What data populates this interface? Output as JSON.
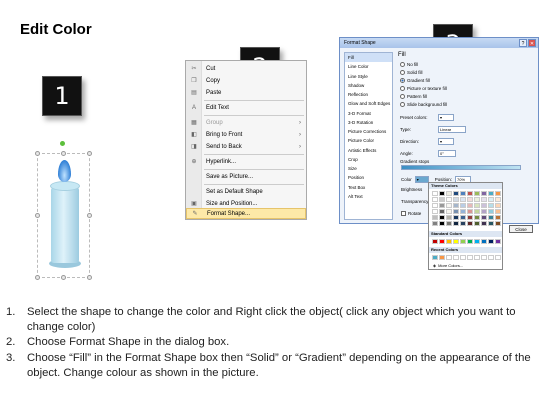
{
  "title": "Edit Color",
  "badges": [
    "1",
    "2",
    "3"
  ],
  "context_menu": {
    "items": [
      {
        "label": "Cut",
        "icon": "scissors-icon",
        "glyph": "✂"
      },
      {
        "label": "Copy",
        "icon": "copy-icon",
        "glyph": "❐"
      },
      {
        "label": "Paste",
        "icon": "paste-icon",
        "glyph": "▤"
      },
      {
        "label": "Edit Text",
        "icon": "edit-text-icon",
        "glyph": "A"
      },
      {
        "label": "Group",
        "icon": "group-icon",
        "glyph": "▦"
      },
      {
        "label": "Bring to Front",
        "icon": "bring-front-icon",
        "glyph": "◧"
      },
      {
        "label": "Send to Back",
        "icon": "send-back-icon",
        "glyph": "◨"
      },
      {
        "label": "Hyperlink...",
        "icon": "hyperlink-icon",
        "glyph": "⊕"
      },
      {
        "label": "Save as Picture...",
        "icon": "",
        "glyph": ""
      },
      {
        "label": "Set as Default Shape",
        "icon": "",
        "glyph": ""
      },
      {
        "label": "Size and Position...",
        "icon": "size-position-icon",
        "glyph": "▣"
      },
      {
        "label": "Format Shape...",
        "icon": "format-shape-icon",
        "glyph": "✎"
      }
    ]
  },
  "dialog": {
    "title": "Format Shape",
    "categories": [
      "Fill",
      "Line Color",
      "Line Style",
      "Shadow",
      "Reflection",
      "Glow and Soft Edges",
      "3-D Format",
      "3-D Rotation",
      "Picture Corrections",
      "Picture Color",
      "Artistic Effects",
      "Crop",
      "Size",
      "Position",
      "Text Box",
      "Alt Text"
    ],
    "fill_heading": "Fill",
    "fill_options": [
      "No fill",
      "Solid fill",
      "Gradient fill",
      "Picture or texture fill",
      "Pattern fill",
      "Slide background fill"
    ],
    "fields": {
      "preset_colors": "Preset colors:",
      "type": "Type:",
      "type_value": "Linear",
      "direction": "Direction:",
      "angle": "Angle:",
      "angle_value": "0°",
      "gradient_stops": "Gradient stops",
      "color": "Color",
      "position": "Position:",
      "position_value": "70%",
      "brightness": "Brightness",
      "transparency": "Transparency",
      "rotate": "Rotate"
    },
    "close": "Close"
  },
  "color_popup": {
    "theme_heading": "Theme Colors",
    "standard_heading": "Standard Colors",
    "recent_heading": "Recent Colors",
    "more_colors": "More Colors...",
    "theme_top": [
      "#ffffff",
      "#000000",
      "#eeece1",
      "#1f497d",
      "#4f81bd",
      "#c0504d",
      "#9bbb59",
      "#8064a2",
      "#4bacc6",
      "#f79646"
    ],
    "standard": [
      "#c00000",
      "#ff0000",
      "#ffc000",
      "#ffff00",
      "#92d050",
      "#00b050",
      "#00b0f0",
      "#0070c0",
      "#002060",
      "#7030a0"
    ],
    "recent": [
      "#4bacc6",
      "#f79646",
      "#ffffff",
      "#ffffff",
      "#ffffff",
      "#ffffff",
      "#ffffff",
      "#ffffff",
      "#ffffff",
      "#ffffff"
    ]
  },
  "instructions": [
    {
      "num": "1.",
      "text": "Select the shape to change the color and Right click the object( click any object which you want to change color)"
    },
    {
      "num": "2.",
      "text": "Choose Format Shape in the dialog box."
    },
    {
      "num": "3.",
      "text": "Choose “Fill” in the Format Shape box then “Solid” or “Gradient” depending on the appearance of the object. Change colour as shown in the picture."
    }
  ]
}
